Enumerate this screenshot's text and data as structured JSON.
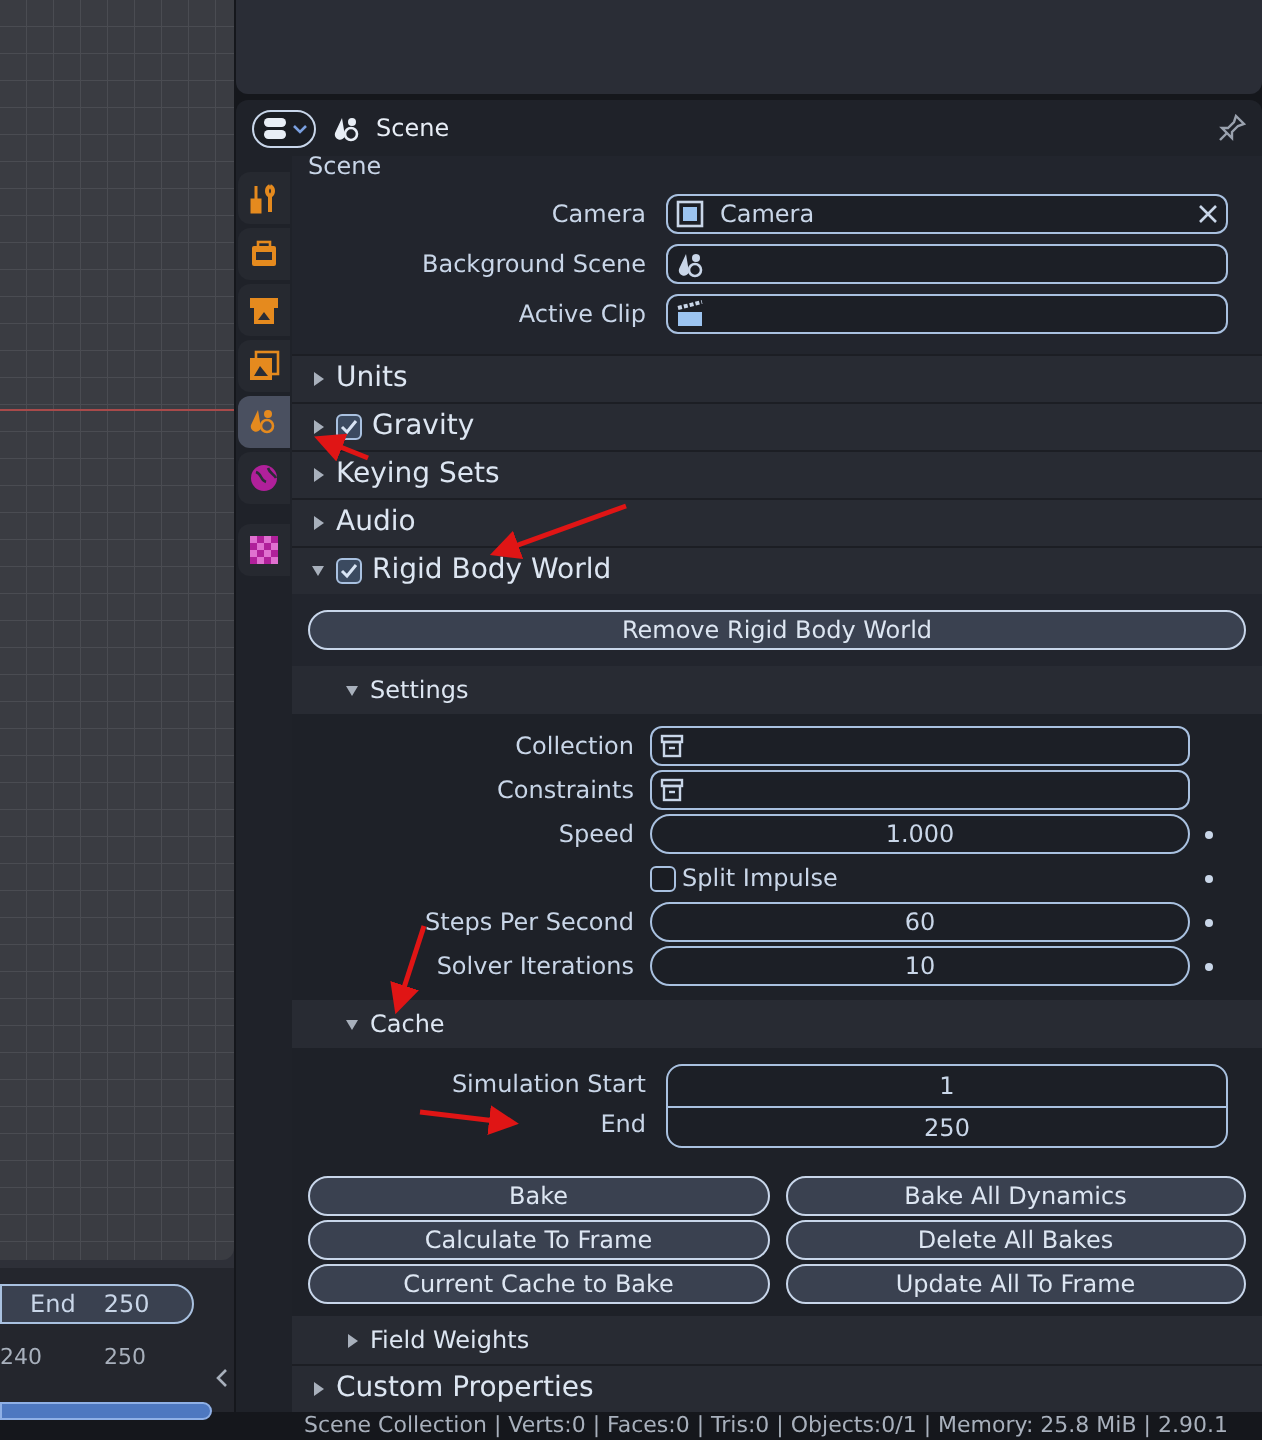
{
  "timeline": {
    "end_label": "End",
    "end_value": "250",
    "ruler_ticks": [
      "240",
      "250"
    ]
  },
  "properties": {
    "header": {
      "title": "Scene"
    },
    "tabs": [
      {
        "kind": "tool",
        "selected": false
      },
      {
        "kind": "render",
        "selected": false
      },
      {
        "kind": "output",
        "selected": false
      },
      {
        "kind": "view_layer",
        "selected": false
      },
      {
        "kind": "scene",
        "selected": true
      },
      {
        "kind": "world",
        "selected": false
      },
      {
        "kind": "texture",
        "selected": false
      }
    ],
    "scene_panel": {
      "title": "Scene",
      "fields": [
        {
          "label": "Camera",
          "value": "Camera"
        },
        {
          "label": "Background Scene"
        },
        {
          "label": "Active Clip"
        }
      ]
    },
    "panels": [
      {
        "title": "Units",
        "expanded": false
      },
      {
        "title": "Gravity",
        "expanded": false,
        "checked": true
      },
      {
        "title": "Keying Sets",
        "expanded": false
      },
      {
        "title": "Audio",
        "expanded": false
      },
      {
        "title": "Rigid Body World",
        "expanded": true,
        "checked": true,
        "body": {
          "remove_button": "Remove Rigid Body World",
          "settings": {
            "title": "Settings",
            "expanded": true,
            "rows": [
              {
                "kind": "picker",
                "label": "Collection"
              },
              {
                "kind": "picker",
                "label": "Constraints"
              },
              {
                "kind": "number",
                "label": "Speed",
                "value": "1.000"
              },
              {
                "kind": "checkbox",
                "label": "Split Impulse",
                "checked": false
              },
              {
                "kind": "number",
                "label": "Steps Per Second",
                "value": "60"
              },
              {
                "kind": "number",
                "label": "Solver Iterations",
                "value": "10"
              }
            ]
          },
          "cache": {
            "title": "Cache",
            "expanded": true,
            "frames": [
              {
                "label": "Simulation Start",
                "value": "1"
              },
              {
                "label": "End",
                "value": "250"
              }
            ],
            "buttons": [
              "Bake",
              "Bake All Dynamics",
              "Calculate To Frame",
              "Delete All Bakes",
              "Current Cache to Bake",
              "Update All To Frame"
            ]
          },
          "field_weights": {
            "title": "Field Weights",
            "expanded": false
          }
        }
      },
      {
        "title": "Custom Properties",
        "expanded": false
      }
    ]
  },
  "status_bar": "Scene Collection | Verts:0 | Faces:0 | Tris:0 | Objects:0/1 | Memory: 25.8 MiB | 2.90.1"
}
